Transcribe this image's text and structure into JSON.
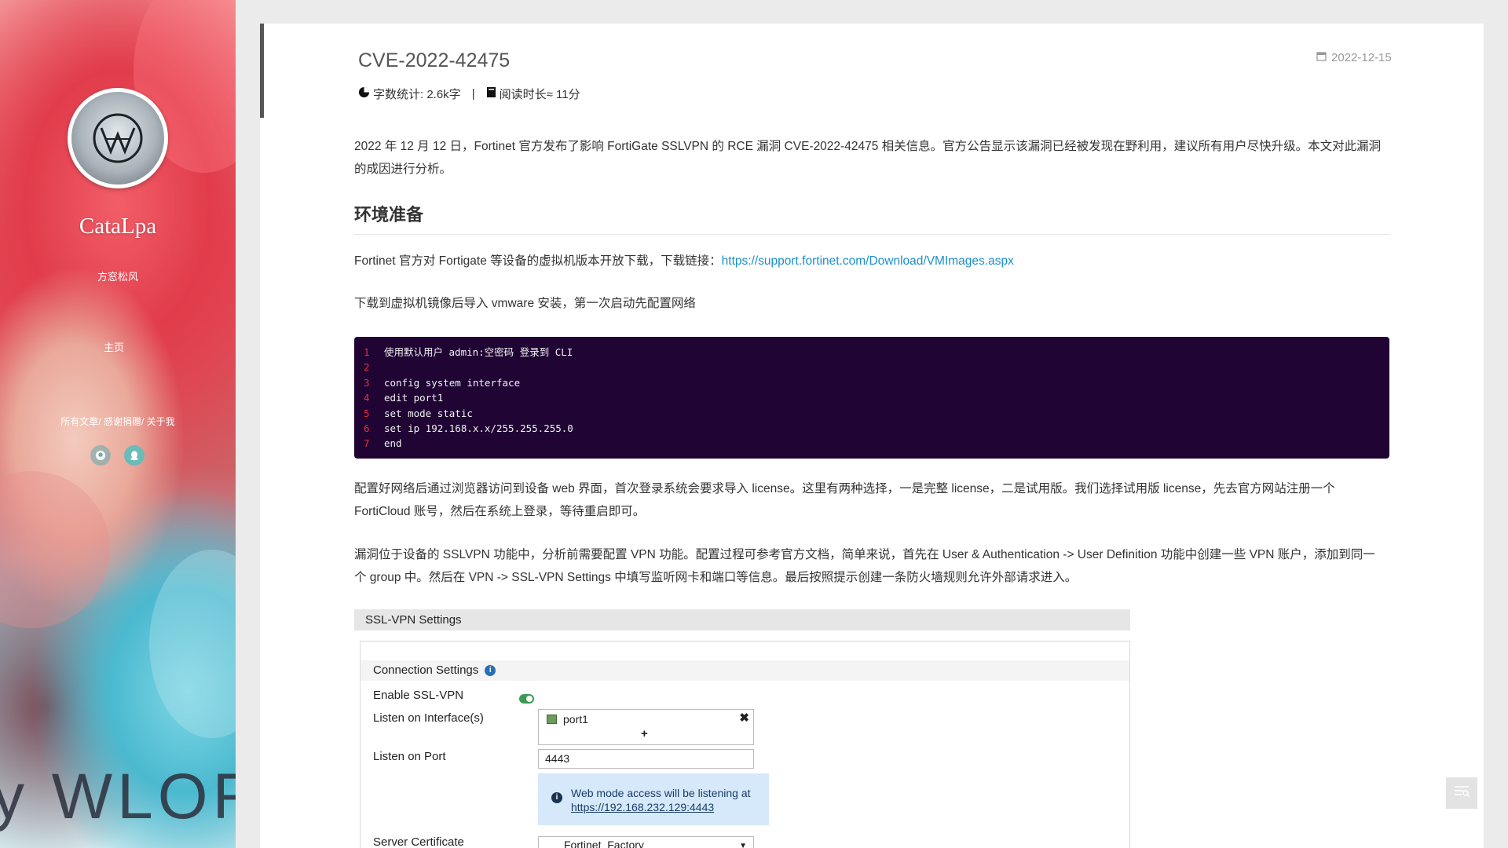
{
  "sidebar": {
    "site_name": "CataLpa",
    "motto": "方窓松风",
    "nav_home": "主页",
    "nav_links": [
      "所有文章",
      "感谢捐赠",
      "关于我"
    ],
    "nav_separator": "/ ",
    "watermark": "y WLOR",
    "social": [
      "github-icon",
      "qq-icon"
    ]
  },
  "post": {
    "title": "CVE-2022-42475",
    "date": "2022-12-15",
    "word_count": "字数统计: 2.6k字",
    "meta_sep": "|",
    "read_time": "阅读时长≈ 11分",
    "intro": "2022 年 12 月 12 日，Fortinet 官方发布了影响 FortiGate SSLVPN 的 RCE 漏洞 CVE-2022-42475 相关信息。官方公告显示该漏洞已经被发现在野利用，建议所有用户尽快升级。本文对此漏洞的成因进行分析。",
    "h2_env": "环境准备",
    "download_text": "Fortinet 官方对 Fortigate 等设备的虚拟机版本开放下载，下载链接：",
    "download_link": "https://support.fortinet.com/Download/VMImages.aspx",
    "vm_text": "下载到虚拟机镜像后导入 vmware 安装，第一次启动先配置网络",
    "code": [
      {
        "n": "1",
        "t": "使用默认用户 admin:空密码 登录到 CLI"
      },
      {
        "n": "2",
        "t": ""
      },
      {
        "n": "3",
        "t": "config system interface"
      },
      {
        "n": "4",
        "t": "edit port1"
      },
      {
        "n": "5",
        "t": "set mode static"
      },
      {
        "n": "6",
        "t": "set ip 192.168.x.x/255.255.255.0"
      },
      {
        "n": "7",
        "t": "end"
      }
    ],
    "config_text": "配置好网络后通过浏览器访问到设备 web 界面，首次登录系统会要求导入 license。这里有两种选择，一是完整 license，二是试用版。我们选择试用版 license，先去官方网站注册一个 FortiCloud 账号，然后在系统上登录，等待重启即可。",
    "vuln_text": "漏洞位于设备的 SSLVPN 功能中，分析前需要配置 VPN 功能。配置过程可参考官方文档，简单来说，首先在 User & Authentication -> User Definition 功能中创建一些 VPN 账户，添加到同一个 group 中。然后在 VPN -> SSL-VPN Settings 中填写监听网卡和端口等信息。最后按照提示创建一条防火墙规则允许外部请求进入。"
  },
  "screenshot": {
    "header": "SSL-VPN Settings",
    "section": "Connection Settings",
    "enable_label": "Enable SSL-VPN",
    "enable_state": true,
    "iface_label": "Listen on Interface(s)",
    "iface_value": "port1",
    "add_glyph": "+",
    "remove_glyph": "✖",
    "port_label": "Listen on Port",
    "port_value": "4443",
    "info_line1": "Web mode access will be listening at",
    "info_link": "https://192.168.232.129:4443",
    "cert_label": "Server Certificate",
    "cert_value": "Fortinet_Factory"
  },
  "colors": {
    "code_bg": "#1f0434",
    "line_number": "#e0303a",
    "link": "#1b8fc9",
    "toggle_on": "#3c9a55"
  }
}
